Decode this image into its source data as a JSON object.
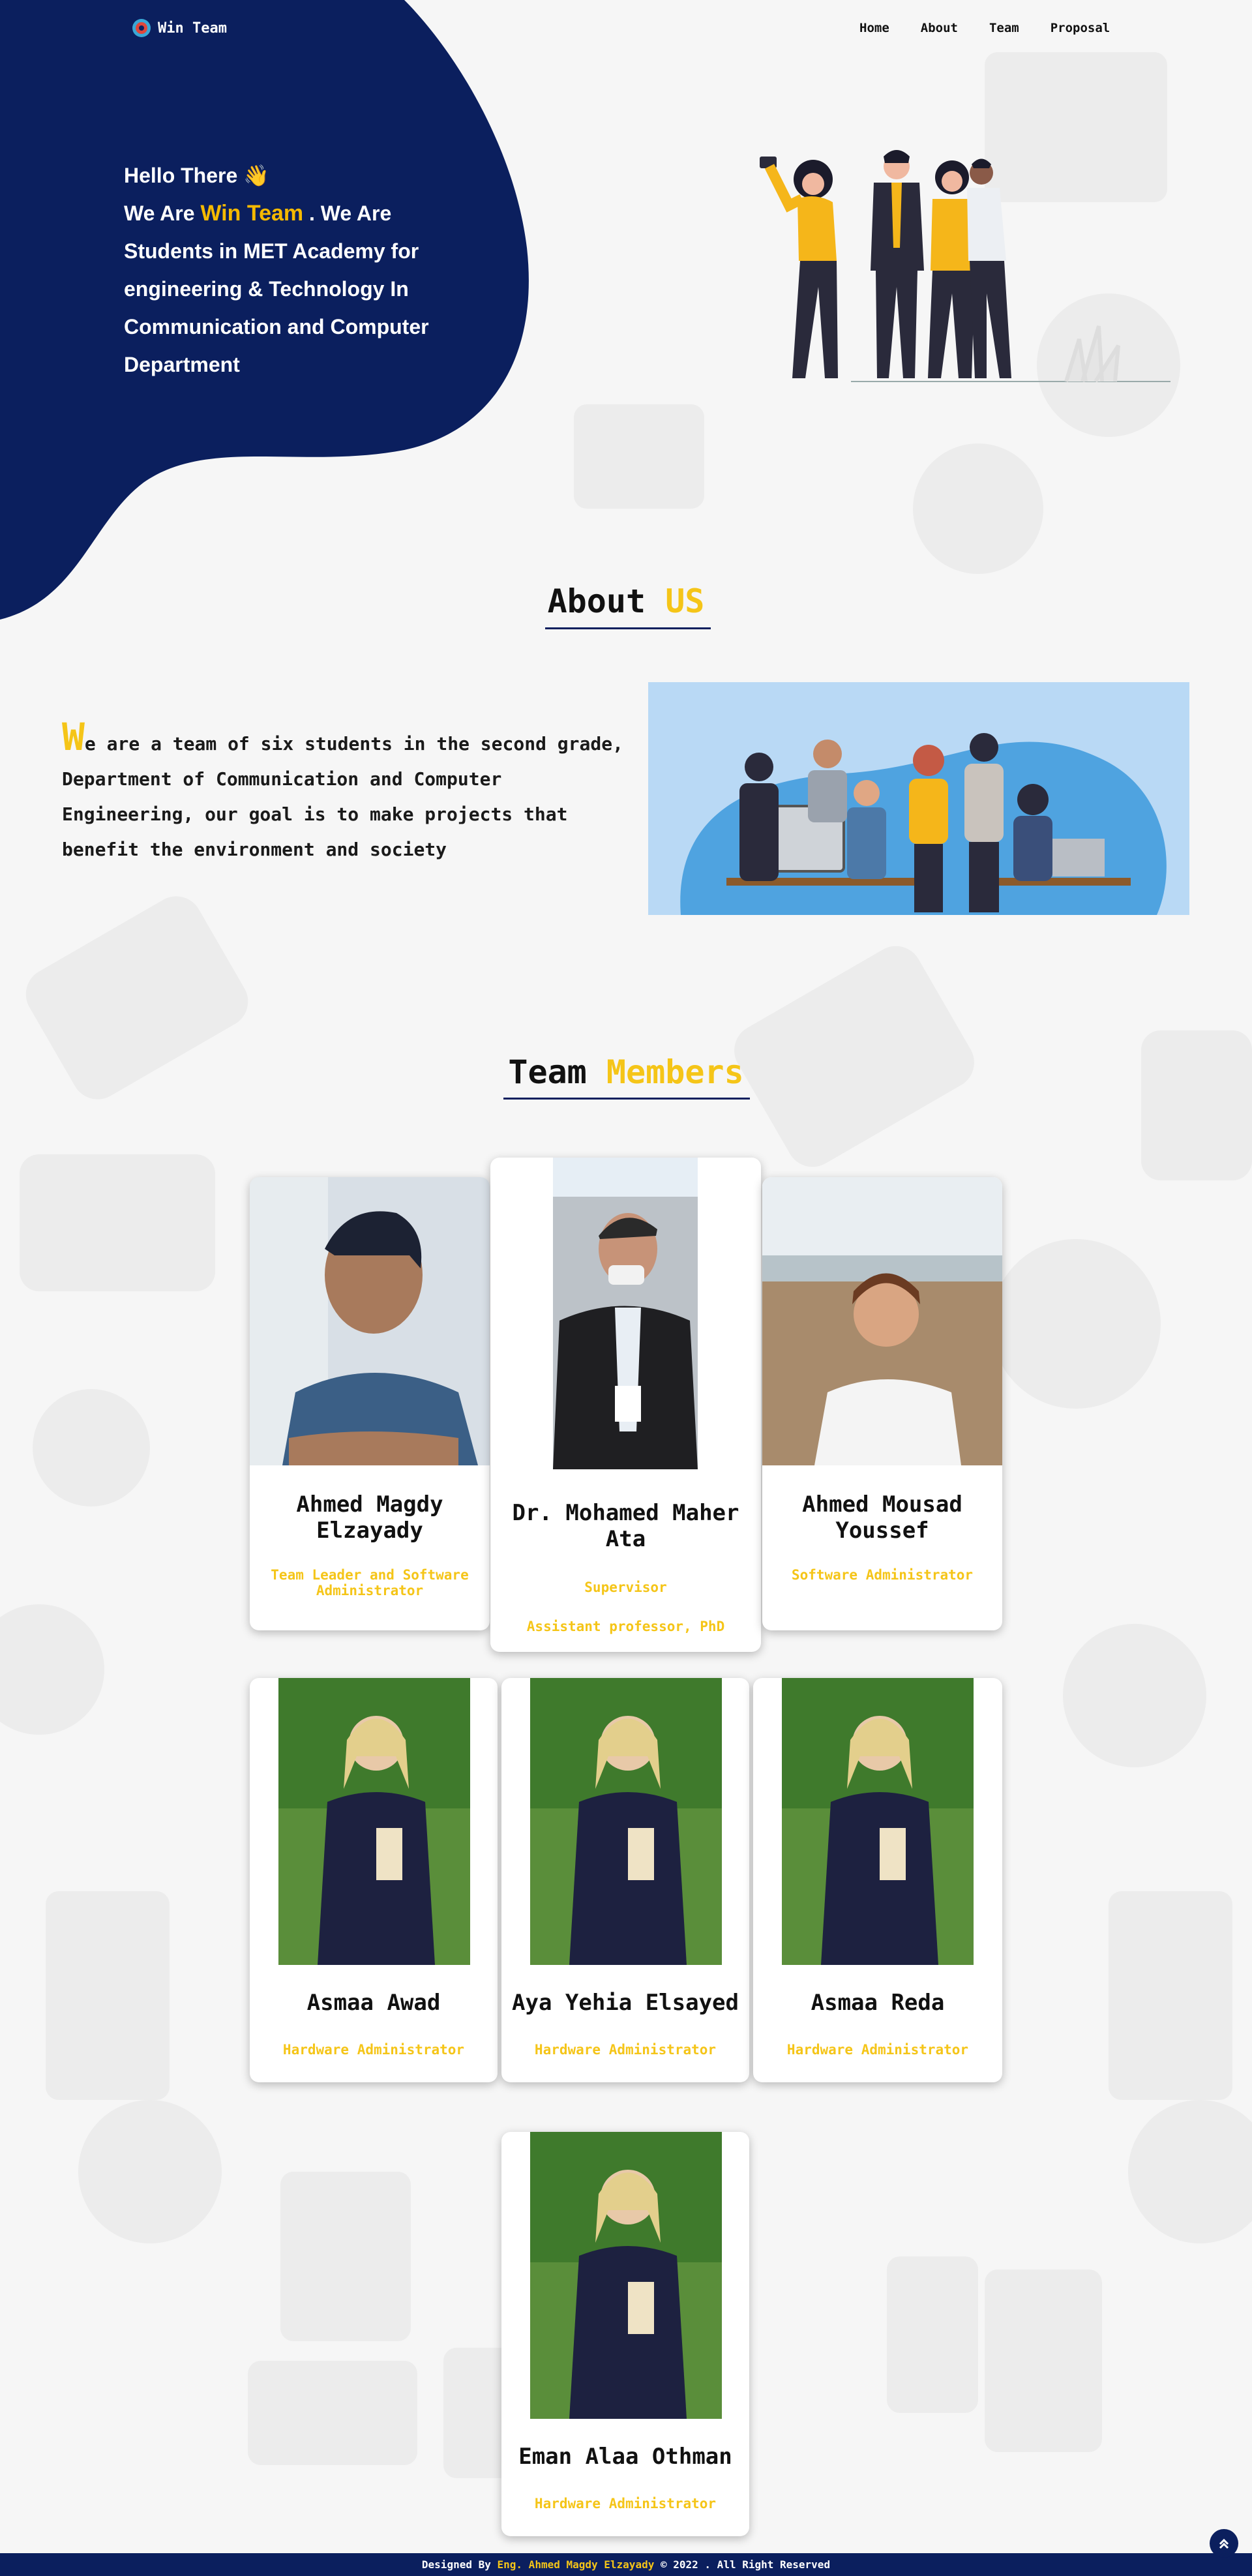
{
  "nav": {
    "brand": "Win Team",
    "links": [
      "Home",
      "About",
      "Team",
      "Proposal"
    ]
  },
  "hero": {
    "greeting": "Hello There",
    "wave_emoji": "👋",
    "we_are": "We Are",
    "team_name": "Win Team",
    "rest": ". We Are Students in MET Academy for engineering & Technology In Communication and Computer Department"
  },
  "about": {
    "title_a": "About",
    "title_b": "US",
    "first_letter": "W",
    "text": "e are a team of six students in the second grade, Department of Communication and Computer Engineering, our goal is to make projects that benefit the environment and society"
  },
  "team": {
    "title_a": "Team",
    "title_b": "Members",
    "members": [
      {
        "name": "Ahmed Magdy Elzayady",
        "role": "Team Leader and Software Administrator"
      },
      {
        "name": "Dr. Mohamed Maher Ata",
        "role": "Supervisor",
        "role2": "Assistant professor, PhD"
      },
      {
        "name": "Ahmed Mousad Youssef",
        "role": "Software Administrator"
      },
      {
        "name": "Asmaa Awad",
        "role": "Hardware Administrator"
      },
      {
        "name": "Aya Yehia Elsayed",
        "role": "Hardware Administrator"
      },
      {
        "name": "Asmaa Reda",
        "role": "Hardware Administrator"
      },
      {
        "name": "Eman Alaa Othman",
        "role": "Hardware Administrator"
      }
    ]
  },
  "footer": {
    "prefix": "Designed By",
    "designer": "Eng. Ahmed Magdy Elzayady",
    "suffix": "© 2022 . All Right Reserved"
  },
  "colors": {
    "navy": "#0b1f5e",
    "accent": "#f5c518",
    "background": "#f6f6f6"
  },
  "icons": [
    "logo-icon",
    "wave-hand-icon",
    "scroll-top-icon"
  ]
}
